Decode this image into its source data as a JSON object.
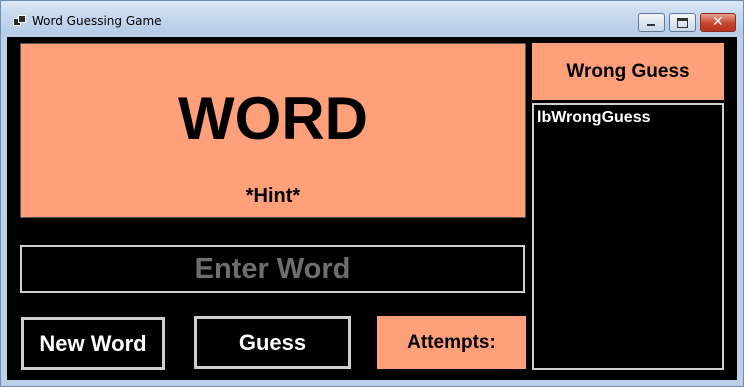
{
  "window": {
    "title": "Word Guessing Game",
    "controls": {
      "minimize": "minimize-icon",
      "maximize": "maximize-icon",
      "close": "close-icon",
      "close_glyph": "✕"
    }
  },
  "word_panel": {
    "word": "WORD",
    "hint": "*Hint*"
  },
  "input": {
    "placeholder": "Enter Word",
    "value": ""
  },
  "buttons": {
    "new_word": "New Word",
    "guess": "Guess"
  },
  "attempts": {
    "label": "Attempts:"
  },
  "wrong_guess": {
    "header": "Wrong Guess",
    "list_text": "lbWrongGuess"
  },
  "colors": {
    "accent": "#ffa07a",
    "background": "#000000",
    "border": "#cfcfcf",
    "placeholder": "#6e6e6e"
  }
}
